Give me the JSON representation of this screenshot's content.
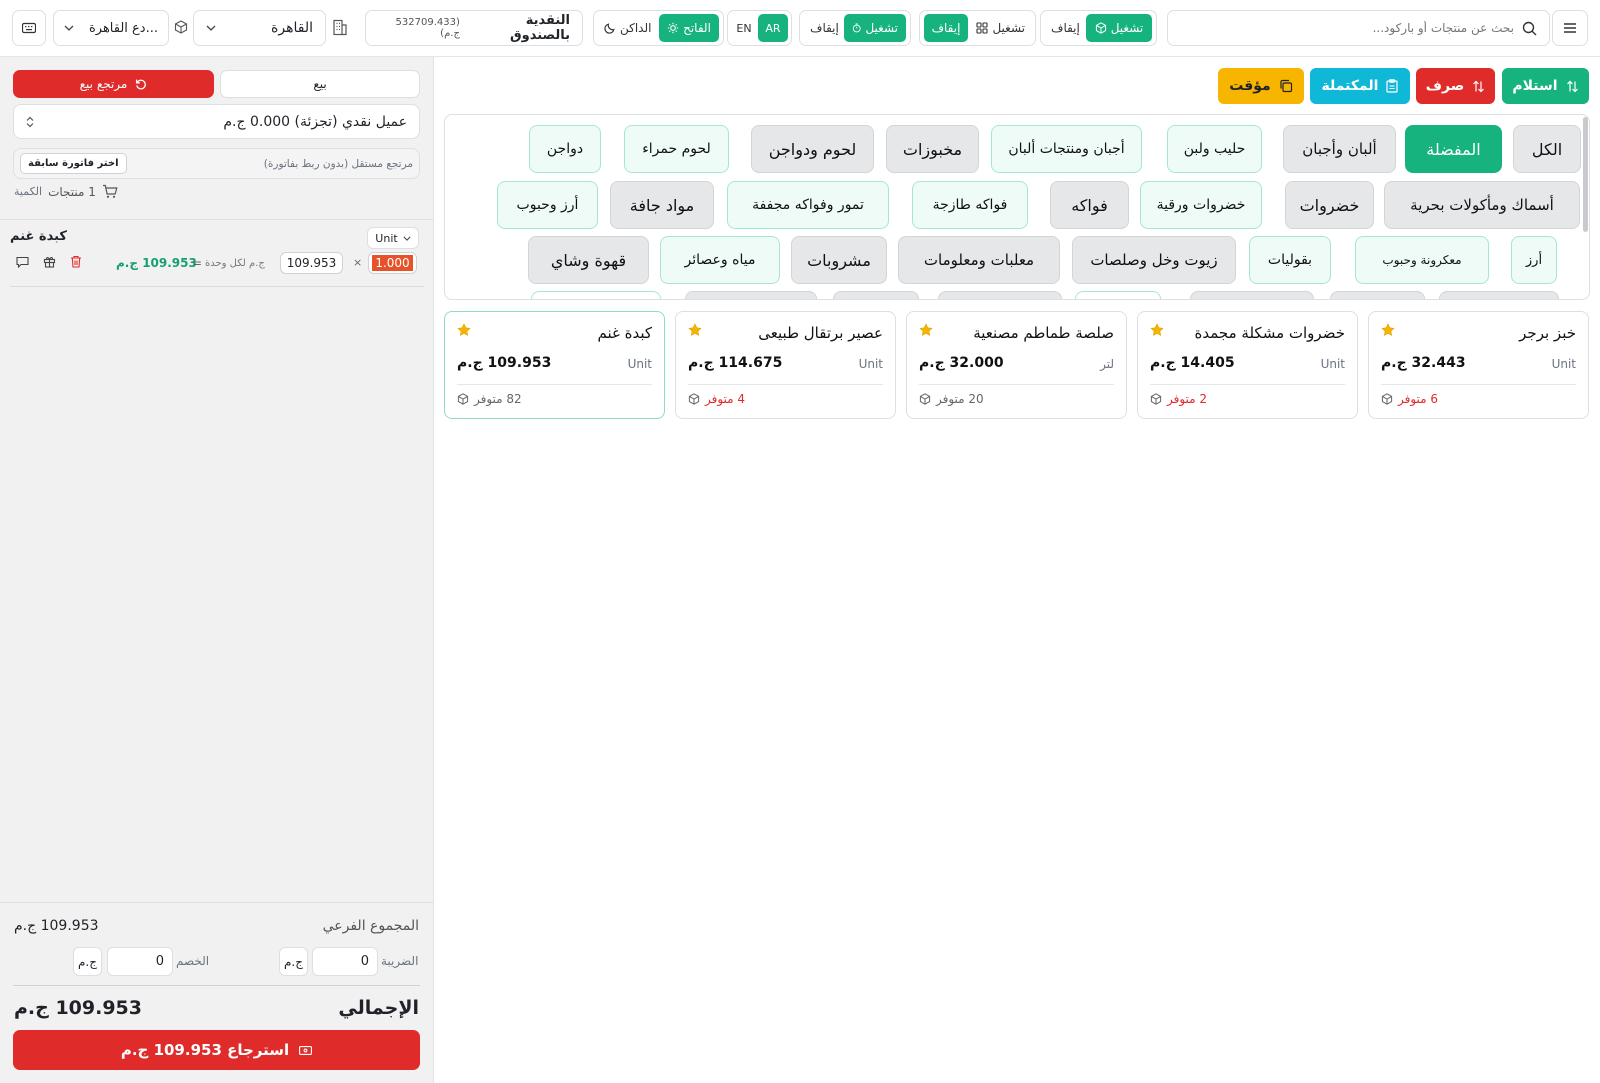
{
  "topbar": {
    "search_placeholder": "بحث عن منتجات أو باركود...",
    "toggle1": {
      "on": "تشغيل",
      "off": "إيقاف"
    },
    "toggle2": {
      "on": "تشغيل",
      "off": "إيقاف"
    },
    "toggle3": {
      "on": "تشغيل",
      "off": "إيقاف"
    },
    "lang": {
      "en": "EN",
      "ar": "AR"
    },
    "theme": {
      "light": "الفاتح",
      "dark": "الداكن"
    },
    "cashbox": {
      "label": "النقدية بالصندوق",
      "amount": "(532709.433 ج.م)"
    },
    "branch": "القاهرة",
    "warehouse": "...دع القاهرة"
  },
  "cart": {
    "tab_sale": "بيع",
    "tab_return": "مرتجع بيع",
    "customer": "عميل نقدي (تجزئة)  0.000 ج.م",
    "return_mode_label": "مرتجع مستقل (بدون ربط بفاتورة)",
    "pick_invoice": "اختر فاتورة سابقة",
    "count_label": "الكمية",
    "count_text": "1 منتجات",
    "items": [
      {
        "name": "كبدة غنم",
        "unit": "Unit",
        "qty": "1.000",
        "price": "109.953",
        "per_unit": "ج.م لكل وحدة",
        "total": "109.953 ج.م"
      }
    ],
    "subtotal_label": "المجموع الفرعي",
    "subtotal_value": "109.953 ج.م",
    "tax_label": "الضريبة",
    "tax_value": "0",
    "tax_unit": "ج.م",
    "discount_label": "الخصم",
    "discount_value": "0",
    "discount_unit": "ج.م",
    "total_label": "الإجمالي",
    "total_value": "109.953 ج.م",
    "refund_button": "استرجاع 109.953 ج.م"
  },
  "actions": {
    "receive": "استلام",
    "spend": "صرف",
    "completed": "المكتملة",
    "temp": "مؤقت"
  },
  "categories": {
    "row1": [
      "الكل",
      "المفضلة",
      "ألبان وأجبان",
      "حليب ولبن",
      "أجبان ومنتجات ألبان",
      "مخبوزات",
      "لحوم ودواجن",
      "لحوم حمراء",
      "دواجن"
    ],
    "row2": [
      "أسماك ومأكولات بحرية",
      "خضروات",
      "خضروات ورقية",
      "فواكه",
      "فواكه طازجة",
      "تمور وفواكه مجففة",
      "مواد جافة",
      "أرز وحبوب"
    ],
    "row3": [
      "أرز",
      "معكرونة وحبوب",
      "بقوليات",
      "زيوت وخل وصلصات",
      "معلبات ومعلومات",
      "مشروبات",
      "مياه وعصائر",
      "قهوة وشاي"
    ]
  },
  "products": [
    {
      "name": "خبز برجر",
      "unit": "Unit",
      "price": "32.443 ج.م",
      "stock": "6 متوفر",
      "low": true
    },
    {
      "name": "خضروات مشكلة مجمدة",
      "unit": "Unit",
      "price": "14.405 ج.م",
      "stock": "2 متوفر",
      "low": true
    },
    {
      "name": "صلصة طماطم مصنعية",
      "unit": "لتر",
      "price": "32.000 ج.م",
      "stock": "20 متوفر",
      "low": false
    },
    {
      "name": "عصير برتقال طبيعى",
      "unit": "Unit",
      "price": "114.675 ج.م",
      "stock": "4 متوفر",
      "low": true
    },
    {
      "name": "كبدة غنم",
      "unit": "Unit",
      "price": "109.953 ج.م",
      "stock": "82 متوفر",
      "low": false
    }
  ],
  "colors": {
    "accent": "#16b37e",
    "danger": "#e02b2b",
    "info": "#10b8d8",
    "warning": "#f7b500"
  }
}
